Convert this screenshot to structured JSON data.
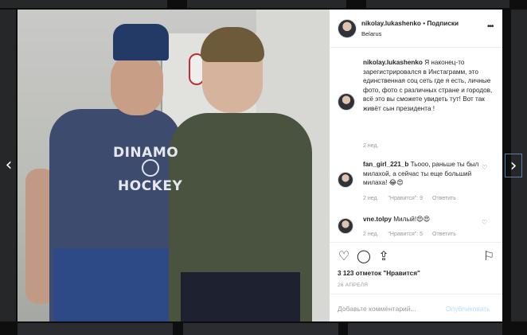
{
  "colors": {
    "link_blue_light": "#b2dffc",
    "modal_bg": "#ffffff",
    "overlay": "rgba(0,0,0,0.35)"
  },
  "navigation": {
    "prev_icon": "chevron-left-icon",
    "next_icon": "chevron-right-icon",
    "prev_glyph": "‹",
    "next_glyph": "›"
  },
  "photo": {
    "shirt_line1": "DINAMO",
    "shirt_line2": "HOCKEY"
  },
  "header": {
    "username": "nikolay.lukashenko",
    "separator": "•",
    "follow_label": "Подписки",
    "location": "Belarus",
    "menu_glyph": "•••"
  },
  "caption": {
    "username": "nikolay.lukashenko",
    "text": "Я наконец-то зарегистрировался в Инстаграмм, это единственная соц сеть где я есть, личные фото, фото с различных стране и городов, всё это вы сможете увидеть тут! Вот так живёт сын президента !",
    "time": "2 нед."
  },
  "comments": [
    {
      "username": "fan_girl_221_b",
      "text": "Тьооо, раньше ты был милахой, а сейчас ты еще больший милаха! 😂😍",
      "time": "2 нед.",
      "likes": "\"Нравится\": 9",
      "reply": "Ответить"
    },
    {
      "username": "vne.tolpy",
      "text": "Милый!😍😍",
      "time": "2 нед.",
      "likes": "\"Нравится\": 5",
      "reply": "Ответить"
    }
  ],
  "actions": {
    "like_icon": "heart-icon",
    "comment_icon": "comment-icon",
    "share_icon": "share-icon",
    "save_icon": "bookmark-icon",
    "like_glyph": "♡",
    "comment_glyph": "◯",
    "share_glyph": "⇪",
    "save_glyph": "⚐",
    "likes_text": "3 123 отметок \"Нравится\"",
    "date": "26 АПРЕЛЯ"
  },
  "add_comment": {
    "placeholder": "Добавьте комментарий...",
    "publish_label": "Опубликовать"
  },
  "comment_like_glyph": "♡"
}
